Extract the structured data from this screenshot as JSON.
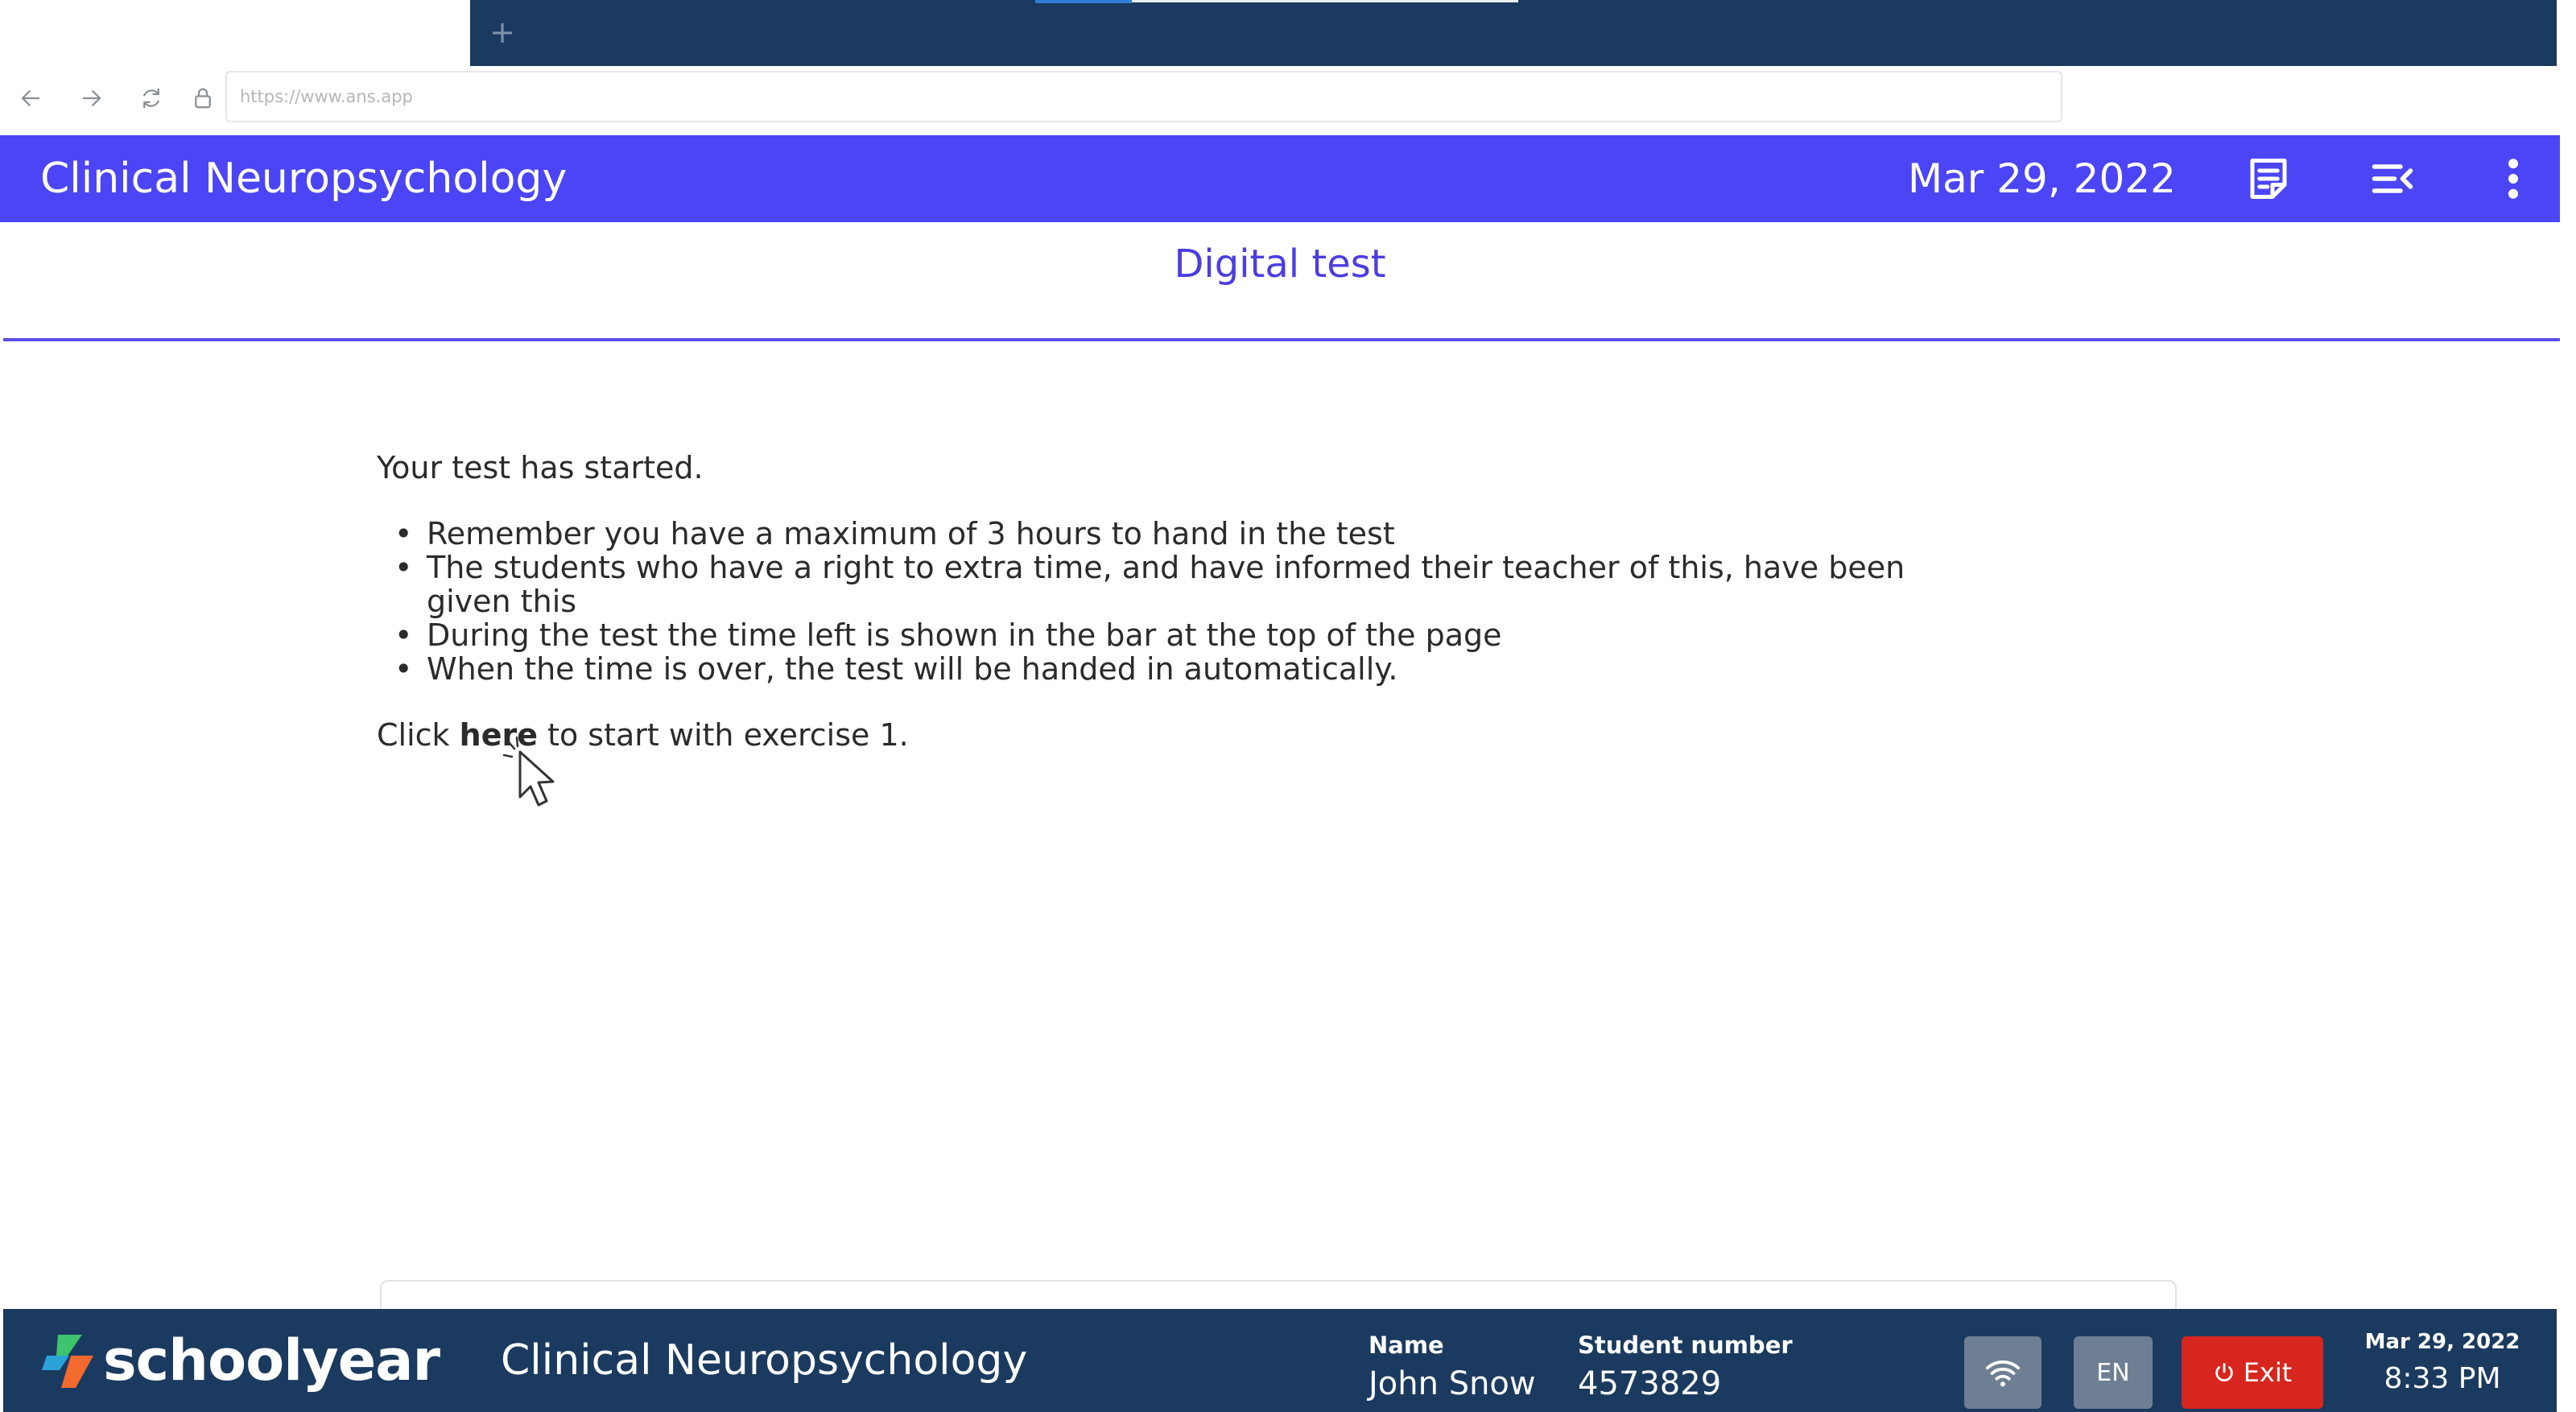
{
  "browser": {
    "new_tab_symbol": "+",
    "url": "https://www.ans.app",
    "icons": [
      "arrow-left-icon",
      "arrow-right-icon",
      "reload-icon",
      "lock-icon"
    ]
  },
  "header": {
    "title": "Clinical Neuropsychology",
    "date": "Mar 29, 2022",
    "icons": [
      "notes-icon",
      "collapse-menu-icon",
      "more-vertical-icon"
    ],
    "color": "#4b45f5"
  },
  "page": {
    "subtitle": "Digital test",
    "intro": "Your test has started.",
    "rules": [
      "Remember you have a maximum of 3 hours to hand in the test",
      "The students who have a right to extra time, and have informed their teacher of this, have been given this",
      "During the test the time left is shown in the bar at the top of the page",
      "When the time is over, the test will be handed in automatically."
    ],
    "start_prefix": "Click",
    "start_link": "here",
    "start_suffix": "to start with exercise 1."
  },
  "footer": {
    "brand": "schoolyear",
    "course": "Clinical Neuropsychology",
    "name_label": "Name",
    "name_value": "John Snow",
    "student_number_label": "Student number",
    "student_number_value": "4573829",
    "language": "EN",
    "exit_label": "Exit",
    "date": "Mar 29, 2022",
    "time": "8:33 PM",
    "icons": [
      "schoolyear-logo-icon",
      "wifi-icon",
      "power-icon"
    ],
    "bar_color": "#1b3a5f",
    "exit_color": "#d7261e"
  }
}
